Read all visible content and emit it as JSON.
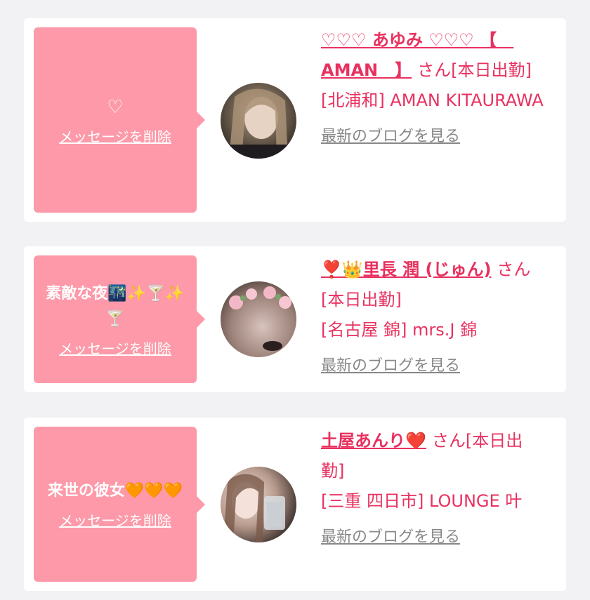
{
  "cards": [
    {
      "message": "♡",
      "delete_label": "メッセージを削除",
      "name": "♡♡♡ あゆみ ♡♡♡ 【　AMAN　】",
      "suffix": "さん[本日出勤]",
      "shop": "[北浦和] AMAN KITAURAWA",
      "blog_label": "最新のブログを見る"
    },
    {
      "message": "素敵な夜🌃✨🍸✨🍸",
      "delete_label": "メッセージを削除",
      "name": "❣️👑里長 潤 (じゅん)",
      "suffix": "さん[本日出勤]",
      "shop": "[名古屋 錦] mrs.J 錦",
      "blog_label": "最新のブログを見る"
    },
    {
      "message": "来世の彼女🧡🧡🧡",
      "delete_label": "メッセージを削除",
      "name": "土屋あんり❤️",
      "suffix": "さん[本日出勤]",
      "shop": "[三重 四日市] LOUNGE 叶",
      "blog_label": "最新のブログを見る"
    }
  ],
  "colors": {
    "accent": "#e8315f",
    "bubble": "#fd99a8",
    "link_gray": "#888888",
    "page_bg": "#f2f2f4"
  }
}
